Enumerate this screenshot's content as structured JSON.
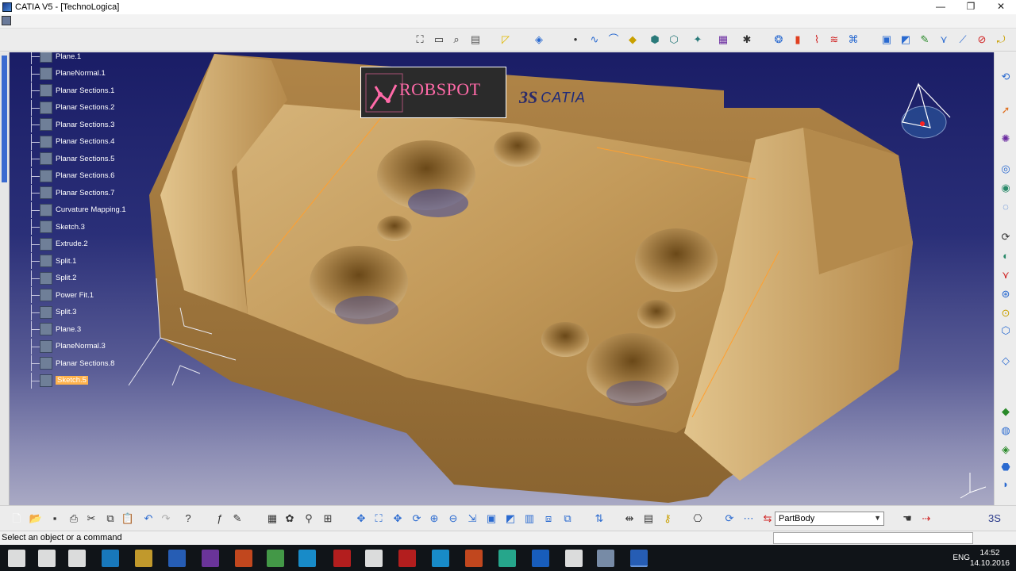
{
  "window": {
    "title": "CATIA V5 - [TechnoLogica]",
    "controls": [
      "—",
      "❐",
      "✕"
    ]
  },
  "tree": {
    "items": [
      {
        "label": "Plane.1",
        "icon": "plane-icon"
      },
      {
        "label": "PlaneNormal.1",
        "icon": "plane-normal-icon"
      },
      {
        "label": "Planar Sections.1",
        "icon": "planar-section-icon"
      },
      {
        "label": "Planar Sections.2",
        "icon": "planar-section-icon"
      },
      {
        "label": "Planar Sections.3",
        "icon": "planar-section-icon"
      },
      {
        "label": "Planar Sections.4",
        "icon": "planar-section-icon"
      },
      {
        "label": "Planar Sections.5",
        "icon": "planar-section-icon"
      },
      {
        "label": "Planar Sections.6",
        "icon": "planar-section-icon"
      },
      {
        "label": "Planar Sections.7",
        "icon": "planar-section-icon"
      },
      {
        "label": "Curvature Mapping.1",
        "icon": "curvature-icon"
      },
      {
        "label": "Sketch.3",
        "icon": "sketch-icon"
      },
      {
        "label": "Extrude.2",
        "icon": "extrude-icon"
      },
      {
        "label": "Split.1",
        "icon": "split-icon"
      },
      {
        "label": "Split.2",
        "icon": "split-icon"
      },
      {
        "label": "Power Fit.1",
        "icon": "power-fit-icon"
      },
      {
        "label": "Split.3",
        "icon": "split-icon"
      },
      {
        "label": "Plane.3",
        "icon": "plane-icon"
      },
      {
        "label": "PlaneNormal.3",
        "icon": "plane-normal-icon"
      },
      {
        "label": "Planar Sections.8",
        "icon": "planar-section-icon"
      },
      {
        "label": "Sketch.5",
        "icon": "sketch-icon",
        "active": true
      }
    ]
  },
  "logos": {
    "robspot": "ROBSPOT",
    "catia": "CATIA"
  },
  "compass_axes": [
    "x",
    "y",
    "z"
  ],
  "toolbar": {
    "current_body": "PartBody",
    "part_color": "#c8a46a",
    "accent": "#ffb34d"
  },
  "status": {
    "message": "Select an object or a command"
  },
  "taskbar": {
    "lang": "ENG",
    "time": "14:52",
    "date": "14.10.2016 г."
  }
}
